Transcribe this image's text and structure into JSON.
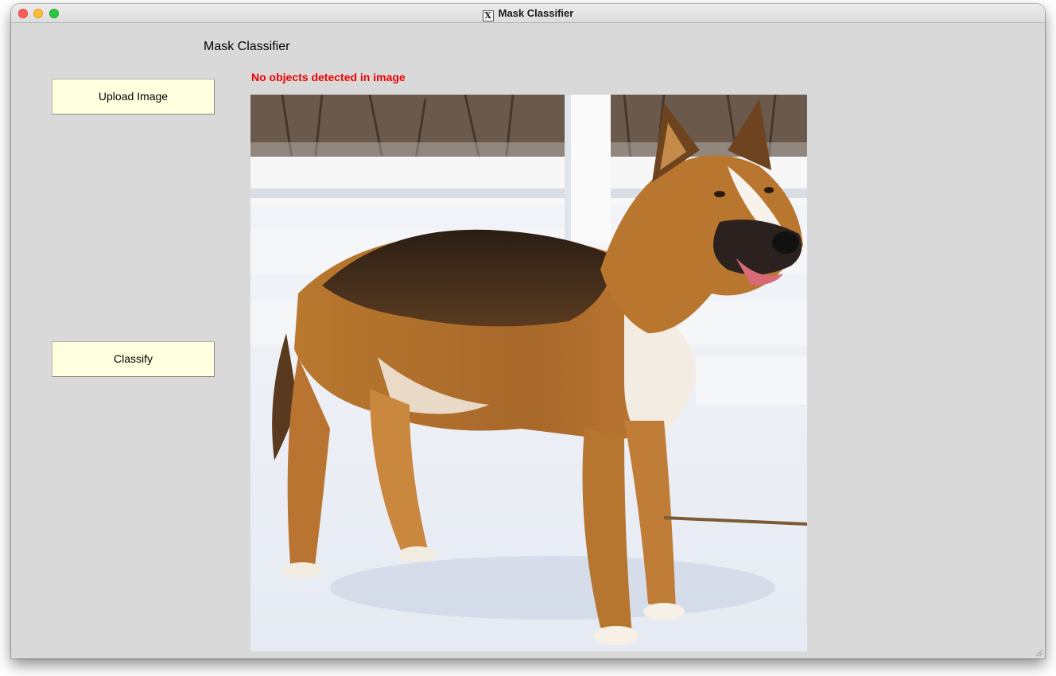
{
  "window": {
    "title": "Mask Classifier"
  },
  "app": {
    "heading": "Mask Classifier",
    "status_message": "No objects detected in image",
    "status_color": "#ee0000"
  },
  "buttons": {
    "upload_label": "Upload Image",
    "classify_label": "Classify",
    "button_color": "#ffffe0"
  },
  "image": {
    "subject": "dog standing on snow in front of white fence"
  }
}
